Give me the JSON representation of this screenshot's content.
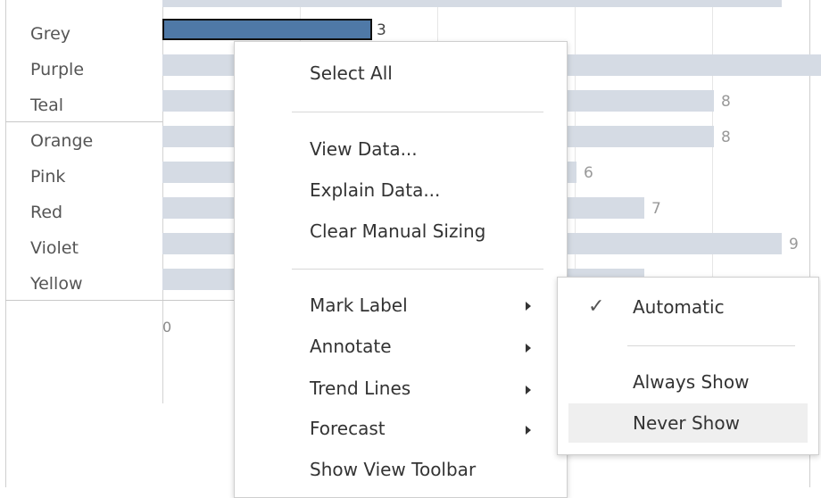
{
  "chart_data": {
    "type": "bar",
    "orientation": "horizontal",
    "categories": [
      "Grey",
      "Purple",
      "Teal",
      "Orange",
      "Pink",
      "Red",
      "Violet",
      "Yellow"
    ],
    "values": [
      3,
      null,
      8,
      8,
      6,
      7,
      9,
      null
    ],
    "value_labels": [
      "3",
      "",
      "8",
      "8",
      "6",
      "7",
      "9",
      ""
    ],
    "axis_tick": "0",
    "selected_category": "Grey",
    "colors": {
      "bar": "#d5dbe4",
      "selected_bar": "#4f79a7"
    }
  },
  "context_menu": {
    "items": [
      {
        "label": "Select All"
      },
      {
        "label": "View Data..."
      },
      {
        "label": "Explain Data..."
      },
      {
        "label": "Clear Manual Sizing"
      },
      {
        "label": "Mark Label",
        "has_submenu": true
      },
      {
        "label": "Annotate",
        "has_submenu": true
      },
      {
        "label": "Trend Lines",
        "has_submenu": true
      },
      {
        "label": "Forecast",
        "has_submenu": true
      },
      {
        "label": "Show View Toolbar"
      }
    ]
  },
  "submenu": {
    "items": [
      {
        "label": "Automatic",
        "checked": true
      },
      {
        "label": "Always Show"
      },
      {
        "label": "Never Show",
        "hovered": true
      }
    ]
  }
}
